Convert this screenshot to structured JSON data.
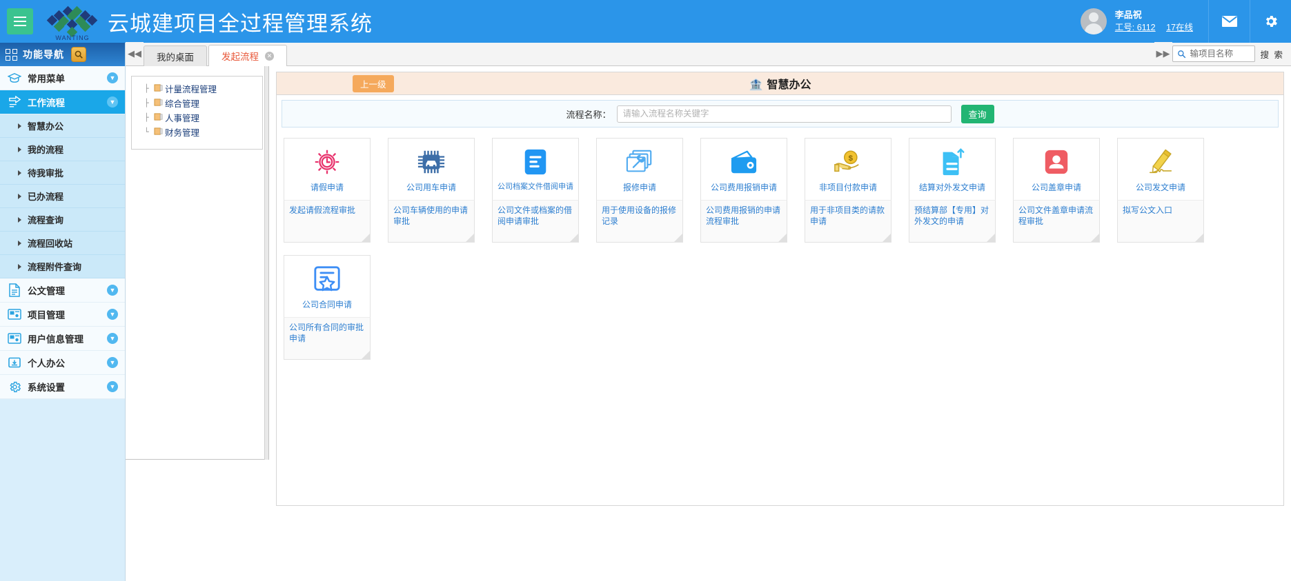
{
  "topbar": {
    "menu_icon": "hamburger-icon",
    "brand_mark": "wanting-logo",
    "brand_sub": "WANTING",
    "title": "云城建项目全过程管理系统",
    "user": {
      "name": "李品祝",
      "id_label": "工号: 6112",
      "online": "17在线"
    },
    "mail_icon": "envelope-icon",
    "settings_icon": "gear-icon",
    "bg_color": "#2b95e9"
  },
  "sidebar": {
    "header": {
      "label": "功能导航",
      "grid_icon": "grid-icon",
      "search_icon": "magnifier-icon"
    },
    "items": [
      {
        "label": "常用菜单",
        "icon": "graduation-cap-icon",
        "type": "group",
        "active": false
      },
      {
        "label": "工作流程",
        "icon": "workflow-icon",
        "type": "group",
        "active": true
      },
      {
        "label": "智慧办公",
        "icon": "triangle-icon",
        "type": "sub"
      },
      {
        "label": "我的流程",
        "icon": "triangle-icon",
        "type": "sub"
      },
      {
        "label": "待我审批",
        "icon": "triangle-icon",
        "type": "sub"
      },
      {
        "label": "已办流程",
        "icon": "triangle-icon",
        "type": "sub"
      },
      {
        "label": "流程查询",
        "icon": "triangle-icon",
        "type": "sub"
      },
      {
        "label": "流程回收站",
        "icon": "triangle-icon",
        "type": "sub"
      },
      {
        "label": "流程附件查询",
        "icon": "triangle-icon",
        "type": "sub"
      },
      {
        "label": "公文管理",
        "icon": "document-icon",
        "type": "group",
        "active": false
      },
      {
        "label": "项目管理",
        "icon": "project-icon",
        "type": "group",
        "active": false
      },
      {
        "label": "用户信息管理",
        "icon": "user-info-icon",
        "type": "group",
        "active": false
      },
      {
        "label": "个人办公",
        "icon": "inbox-icon",
        "type": "group",
        "active": false
      },
      {
        "label": "系统设置",
        "icon": "gear-icon",
        "type": "group",
        "active": false
      }
    ]
  },
  "tabbar": {
    "collapse_icon": "double-chevron-left-icon",
    "expand_icon": "double-chevron-right-icon",
    "tabs": [
      {
        "label": "我的桌面",
        "active": false,
        "closable": false
      },
      {
        "label": "发起流程",
        "active": true,
        "closable": true
      }
    ],
    "search": {
      "placeholder": "输项目名称",
      "value": "",
      "icon": "search-icon",
      "button": "搜 索"
    }
  },
  "tree": {
    "nodes": [
      {
        "label": "计量流程管理",
        "icon": "folder-icon"
      },
      {
        "label": "综合管理",
        "icon": "folder-icon"
      },
      {
        "label": "人事管理",
        "icon": "folder-icon"
      },
      {
        "label": "财务管理",
        "icon": "folder-icon"
      }
    ]
  },
  "panel": {
    "up_level_button": "上一级",
    "title": "智慧办公",
    "title_icon": "bank-icon",
    "header_bg": "#faeade",
    "filter": {
      "label": "流程名称：",
      "placeholder": "请输入流程名称关键字",
      "value": "",
      "button": "查询",
      "button_color": "#22b573"
    }
  },
  "cards": [
    {
      "title": "请假申请",
      "desc": "发起请假流程审批",
      "icon": "clock-gear-icon",
      "color": "#e8336d"
    },
    {
      "title": "公司用车申请",
      "desc": "公司车辆使用的申请审批",
      "icon": "car-chip-icon",
      "color": "#3d6ea8"
    },
    {
      "title": "公司档案文件借阅申请",
      "desc": "公司文件或档案的借阅申请审批",
      "icon": "document-lines-icon",
      "color": "#2196f3"
    },
    {
      "title": "报修申请",
      "desc": "用于使用设备的报修记录",
      "icon": "wrench-window-icon",
      "color": "#4eaaf0"
    },
    {
      "title": "公司费用报销申请",
      "desc": "公司费用报销的申请流程审批",
      "icon": "wallet-icon",
      "color": "#1e9cf0"
    },
    {
      "title": "非项目付款申请",
      "desc": "用于非项目类的请款申请",
      "icon": "hand-coin-icon",
      "color": "#f2c230"
    },
    {
      "title": "结算对外发文申请",
      "desc": "预结算部【专用】对外发文的申请",
      "icon": "file-upload-icon",
      "color": "#3dc0f5"
    },
    {
      "title": "公司盖章申请",
      "desc": "公司文件盖章申请流程审批",
      "icon": "stamp-icon",
      "color": "#ef5c63"
    },
    {
      "title": "公司发文申请",
      "desc": "拟写公文入口",
      "icon": "pencil-sign-icon",
      "color": "#f2d24b"
    },
    {
      "title": "公司合同申请",
      "desc": "公司所有合同的审批申请",
      "icon": "contract-star-icon",
      "color": "#3d8ef5"
    }
  ]
}
